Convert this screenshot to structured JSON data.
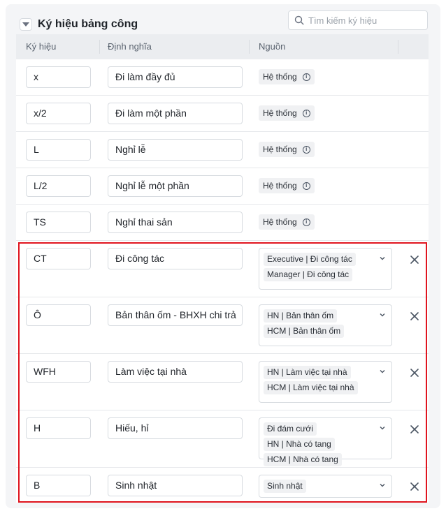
{
  "section": {
    "title": "Ký hiệu bảng công",
    "collapse_icon": "triangle-down-icon"
  },
  "search": {
    "placeholder": "Tìm kiếm ký hiệu",
    "value": ""
  },
  "table": {
    "columns": [
      "Ký hiệu",
      "Định nghĩa",
      "Nguồn"
    ],
    "system_rows": [
      {
        "symbol": "x",
        "definition": "Đi làm đầy đủ",
        "source": "Hệ thống"
      },
      {
        "symbol": "x/2",
        "definition": "Đi làm một phần",
        "source": "Hệ thống"
      },
      {
        "symbol": "L",
        "definition": "Nghỉ lễ",
        "source": "Hệ thống"
      },
      {
        "symbol": "L/2",
        "definition": "Nghỉ lễ một phần",
        "source": "Hệ thống"
      },
      {
        "symbol": "TS",
        "definition": "Nghỉ thai sản",
        "source": "Hệ thống"
      }
    ],
    "custom_rows": [
      {
        "symbol": "CT",
        "definition": "Đi công tác",
        "sources": [
          "Executive | Đi công tác",
          "Manager | Đi công tác"
        ]
      },
      {
        "symbol": "Ô",
        "definition": "Bản thân ốm - BHXH chi trả",
        "sources": [
          "HN | Bản thân ốm",
          "HCM | Bản thân ốm"
        ]
      },
      {
        "symbol": "WFH",
        "definition": "Làm việc tại nhà",
        "sources": [
          "HN | Làm việc tại nhà",
          "HCM | Làm việc tại nhà"
        ]
      },
      {
        "symbol": "H",
        "definition": "Hiếu, hỉ",
        "sources": [
          "Đi đám cưới",
          "HN | Nhà có tang",
          "HCM | Nhà có tang"
        ]
      },
      {
        "symbol": "B",
        "definition": "Sinh nhật",
        "sources": [
          "Sinh nhật"
        ]
      }
    ]
  },
  "colors": {
    "highlight_border": "#e0141e",
    "panel_bg": "#f4f5f7",
    "header_bg": "#ebedf0"
  }
}
